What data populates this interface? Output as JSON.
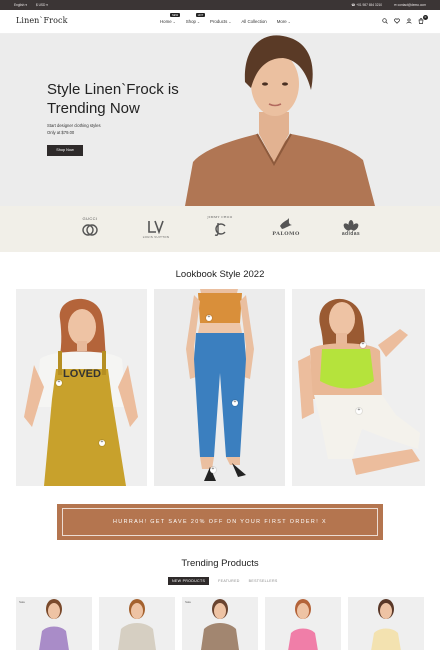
{
  "topbar": {
    "language": "English",
    "currency": "$ USD",
    "phone": "+01 987 654 3210",
    "email": "contact@demo.com"
  },
  "header": {
    "logo": "Linen`Frock",
    "nav": [
      {
        "label": "Home",
        "badge": "NEW"
      },
      {
        "label": "Shop",
        "badge": "HOT"
      },
      {
        "label": "Products",
        "badge": ""
      },
      {
        "label": "All Collection",
        "badge": ""
      },
      {
        "label": "More",
        "badge": ""
      }
    ],
    "cart_count": "0",
    "icons": [
      "search-icon",
      "heart-icon",
      "user-icon",
      "cart-icon"
    ]
  },
  "hero": {
    "title": "Style Linen`Frock is Trending Now",
    "subtitle": "Start designer clothing styles",
    "price_line": "Only at $79.00",
    "button": "Shop Now"
  },
  "brands": [
    "GUCCI",
    "LOUIS VUITTON",
    "JIMMY CHOO",
    "PALOMO",
    "adidas"
  ],
  "lookbook": {
    "title": "Lookbook Style 2022",
    "shirt_text": "LOVED"
  },
  "banner": {
    "text": "HURRAH! GET SAVE 20% OFF ON YOUR FIRST ORDER! X"
  },
  "trending": {
    "title": "Trending Products",
    "tabs": [
      "NEW PRODUCTS",
      "FEATURED",
      "BESTSELLERS"
    ],
    "sale_label": "Sale"
  },
  "colors": {
    "topbar": "#3b3535",
    "brand_strip": "#f1efe8",
    "banner": "#b4754f",
    "button_dark": "#2e2a2a"
  }
}
